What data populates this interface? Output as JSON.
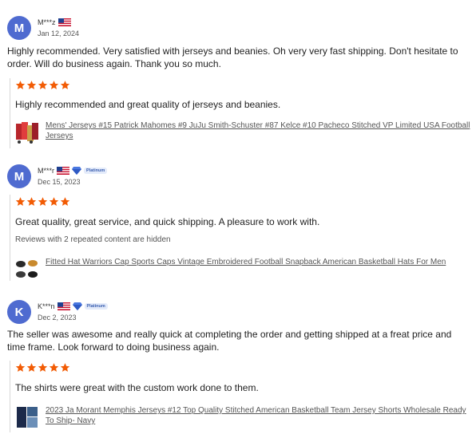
{
  "colors": {
    "star": "#f25c05",
    "avatar": "#4f6bd0",
    "link": "#555555",
    "platinum": "#3a5fb0"
  },
  "reviews": [
    {
      "avatar_letter": "M",
      "username": "M***z",
      "badge": "",
      "date": "Jan 12, 2024",
      "text": "Highly recommended. Very satisfied with jerseys and beanies. Oh very very fast shipping. Don't hesitate to order. Will do business again. Thank you so much.",
      "rating": 5,
      "reply_text": "Highly recommended and great quality of jerseys and beanies.",
      "hidden_note": "",
      "product": "Mens' Jerseys #15 Patrick Mahomes #9 JuJu Smith-Schuster #87 Kelce #10 Pacheco Stitched VP Limited USA Football Jerseys"
    },
    {
      "avatar_letter": "M",
      "username": "M***r",
      "badge": "Platinum",
      "date": "Dec 15, 2023",
      "text": "",
      "rating": 5,
      "reply_text": "Great quality, great service, and quick shipping. A pleasure to work with.",
      "hidden_note": "Reviews with 2 repeated content are hidden",
      "product": "Fitted Hat Warriors Cap Sports Caps Vintage Embroidered Football Snapback American Basketball Hats For Men"
    },
    {
      "avatar_letter": "K",
      "username": "K***n",
      "badge": "Platinum",
      "date": "Dec 2, 2023",
      "text": "The seller was awesome and really quick at completing the order and getting shipped at a freat price and time frame. Look forward to doing business again.",
      "rating": 5,
      "reply_text": "The shirts were great with the custom work done to them.",
      "hidden_note": "",
      "product": "2023 Ja Morant Memphis Jerseys #12 Top Quality Stitched American Basketball Team Jersey Shorts Wholesale Ready To Ship- Navy"
    }
  ]
}
